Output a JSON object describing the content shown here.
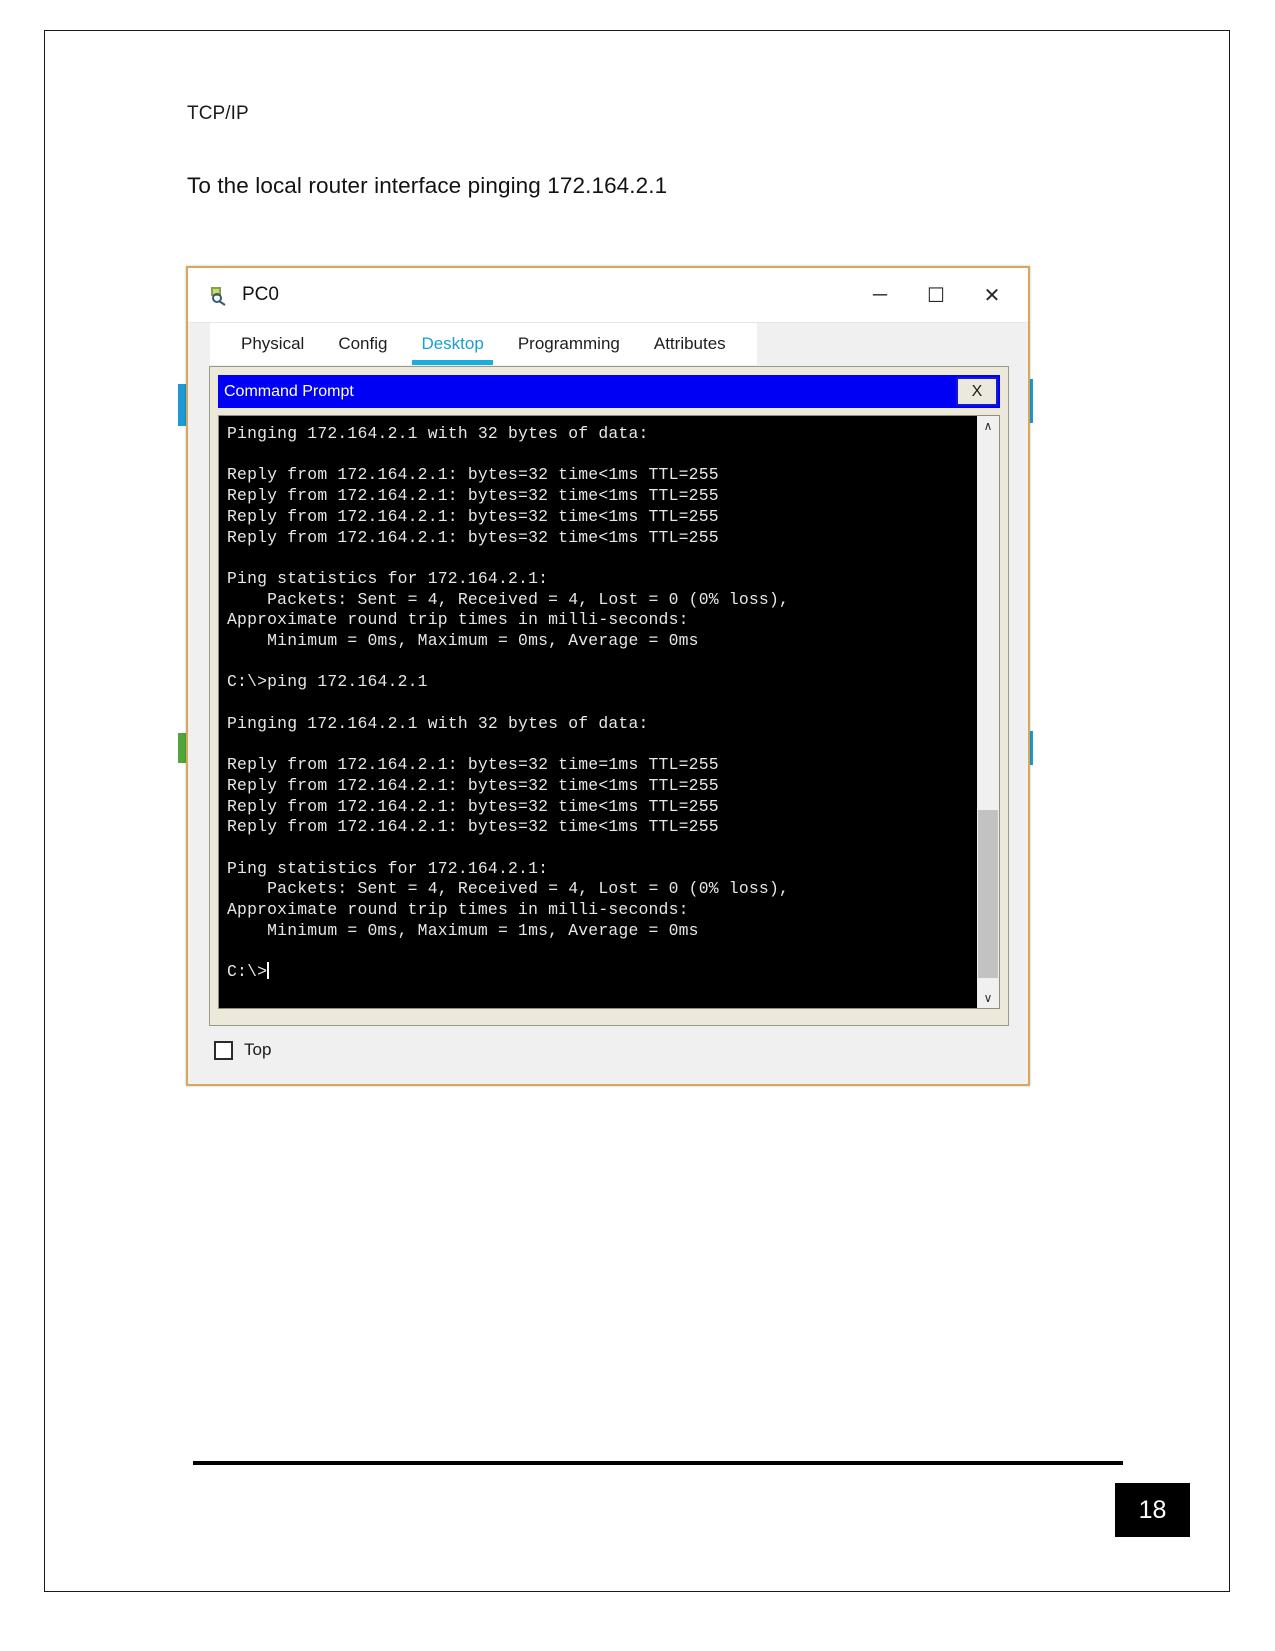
{
  "document": {
    "heading": "TCP/IP",
    "paragraph": "To the local router interface pinging 172.164.2.1",
    "page_number": "18"
  },
  "pc_window": {
    "title": "PC0",
    "app_icon": "packet-tracer-pc-icon",
    "controls": {
      "minimize": "─",
      "maximize": "☐",
      "close": "✕"
    },
    "tabs": [
      {
        "label": "Physical",
        "active": false
      },
      {
        "label": "Config",
        "active": false
      },
      {
        "label": "Desktop",
        "active": true
      },
      {
        "label": "Programming",
        "active": false
      },
      {
        "label": "Attributes",
        "active": false
      }
    ],
    "active_tab": "Desktop",
    "top_checkbox": {
      "label": "Top",
      "checked": false
    }
  },
  "command_prompt": {
    "title": "Command Prompt",
    "close_label": "X",
    "console_text": "Pinging 172.164.2.1 with 32 bytes of data:\n\nReply from 172.164.2.1: bytes=32 time<1ms TTL=255\nReply from 172.164.2.1: bytes=32 time<1ms TTL=255\nReply from 172.164.2.1: bytes=32 time<1ms TTL=255\nReply from 172.164.2.1: bytes=32 time<1ms TTL=255\n\nPing statistics for 172.164.2.1:\n    Packets: Sent = 4, Received = 4, Lost = 0 (0% loss),\nApproximate round trip times in milli-seconds:\n    Minimum = 0ms, Maximum = 0ms, Average = 0ms\n\nC:\\>ping 172.164.2.1\n\nPinging 172.164.2.1 with 32 bytes of data:\n\nReply from 172.164.2.1: bytes=32 time=1ms TTL=255\nReply from 172.164.2.1: bytes=32 time<1ms TTL=255\nReply from 172.164.2.1: bytes=32 time<1ms TTL=255\nReply from 172.164.2.1: bytes=32 time<1ms TTL=255\n\nPing statistics for 172.164.2.1:\n    Packets: Sent = 4, Received = 4, Lost = 0 (0% loss),\nApproximate round trip times in milli-seconds:\n    Minimum = 0ms, Maximum = 1ms, Average = 0ms\n\nC:\\>",
    "prompt": "C:\\>",
    "scrollbar": {
      "up_arrow": "∧",
      "down_arrow": "∨"
    }
  },
  "colors": {
    "cmd_titlebar": "#0000f5",
    "accent_tab": "#1aaede",
    "window_border": "#d8a85a",
    "console_bg": "#000000",
    "console_fg": "#e7e7e7"
  }
}
